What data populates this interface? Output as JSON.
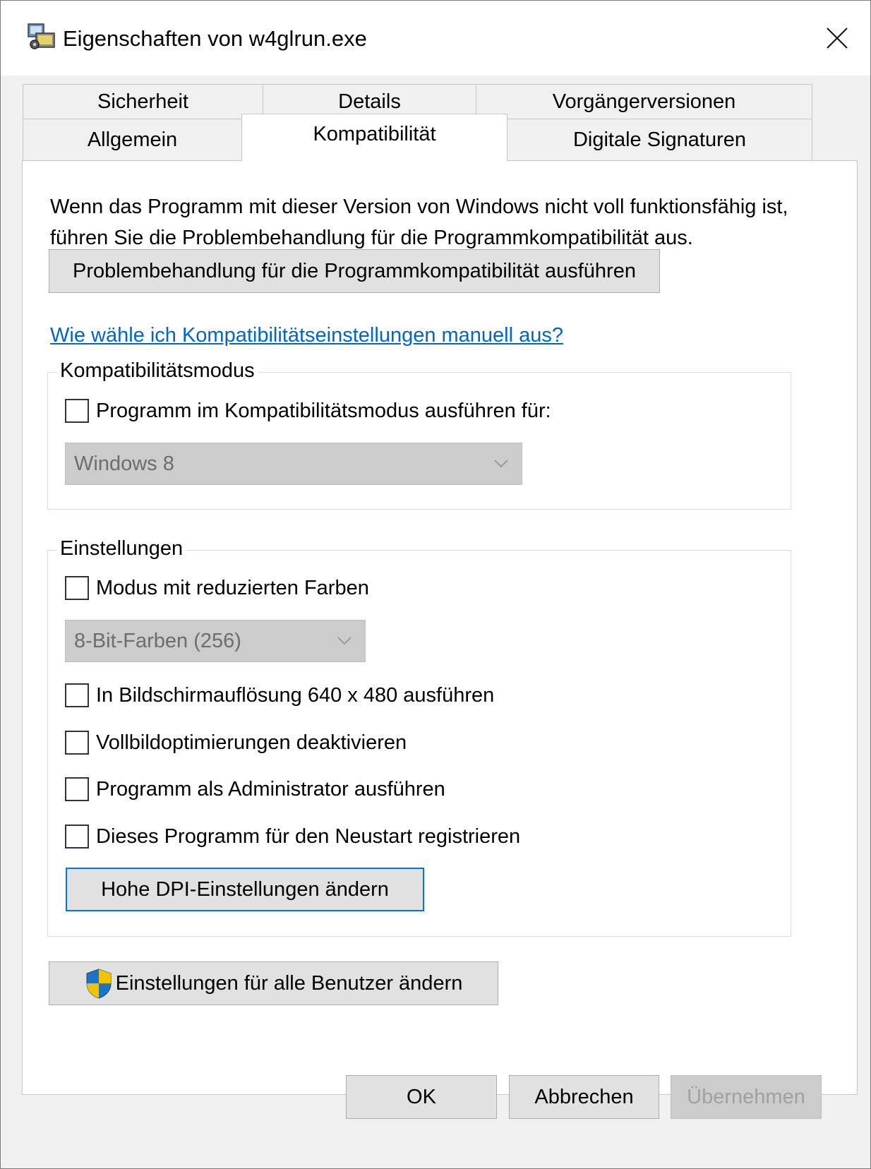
{
  "window": {
    "title": "Eigenschaften von w4glrun.exe"
  },
  "tabs": {
    "row_top": [
      "Sicherheit",
      "Details",
      "Vorgängerversionen"
    ],
    "row_bottom": [
      "Allgemein",
      "Kompatibilität",
      "Digitale Signaturen"
    ],
    "active": "Kompatibilität"
  },
  "compat": {
    "description": "Wenn das Programm mit dieser Version von Windows nicht voll funktionsfähig ist, führen Sie die Problembehandlung für die Programmkompatibilität aus.",
    "troubleshoot_button": "Problembehandlung für die Programmkompatibilität ausführen",
    "help_link": "Wie wähle ich Kompatibilitätseinstellungen manuell aus?"
  },
  "compat_mode": {
    "group_label": "Kompatibilitätsmodus",
    "checkbox_label": "Programm im Kompatibilitätsmodus ausführen für:",
    "checked": false,
    "selected_os": "Windows 8"
  },
  "settings": {
    "group_label": "Einstellungen",
    "reduced_color": {
      "label": "Modus mit reduzierten Farben",
      "checked": false
    },
    "color_depth": "8-Bit-Farben (256)",
    "res640": {
      "label": "In Bildschirmauflösung 640 x 480 ausführen",
      "checked": false
    },
    "fullscreen_opt": {
      "label": "Vollbildoptimierungen deaktivieren",
      "checked": false
    },
    "run_admin": {
      "label": "Programm als Administrator ausführen",
      "checked": false
    },
    "restart_register": {
      "label": "Dieses Programm für den Neustart registrieren",
      "checked": false
    },
    "dpi_button": "Hohe DPI-Einstellungen ändern"
  },
  "all_users_button": "Einstellungen für alle Benutzer ändern",
  "footer": {
    "ok": "OK",
    "cancel": "Abbrechen",
    "apply": "Übernehmen"
  },
  "colors": {
    "accent": "#0078d7",
    "link": "#0066cc",
    "shield_blue": "#1e73c9",
    "shield_yellow": "#f2c200"
  }
}
